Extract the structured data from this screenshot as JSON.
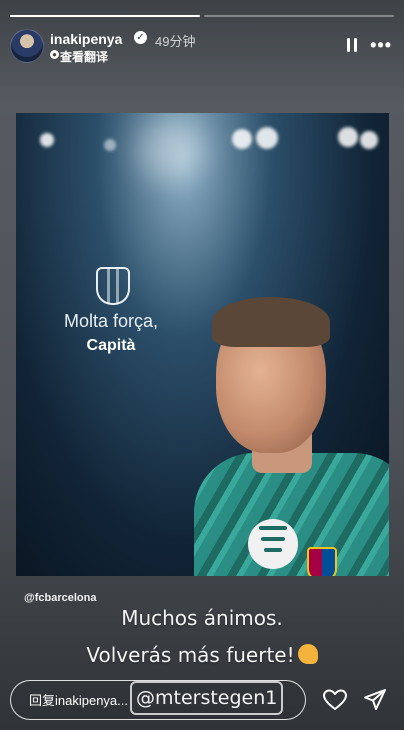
{
  "story": {
    "progress": [
      1.0,
      0.0
    ],
    "username": "inakipenya",
    "timestamp": "49分钟",
    "translate_label": "查看翻译"
  },
  "poster": {
    "slogan_line1": "Molta força,",
    "slogan_line2": "Capità"
  },
  "credit": "@fcbarcelona",
  "caption": {
    "line1": "Muchos ánimos.",
    "line2": "Volverás más fuerte!",
    "mention": "@mterstegen1"
  },
  "reply": {
    "placeholder": "回复inakipenya..."
  },
  "icons": {
    "verified": "verified-badge-icon",
    "pause": "pause-icon",
    "more": "more-icon",
    "heart": "heart-icon",
    "send": "send-icon",
    "emoji": "flexed-biceps-icon"
  }
}
